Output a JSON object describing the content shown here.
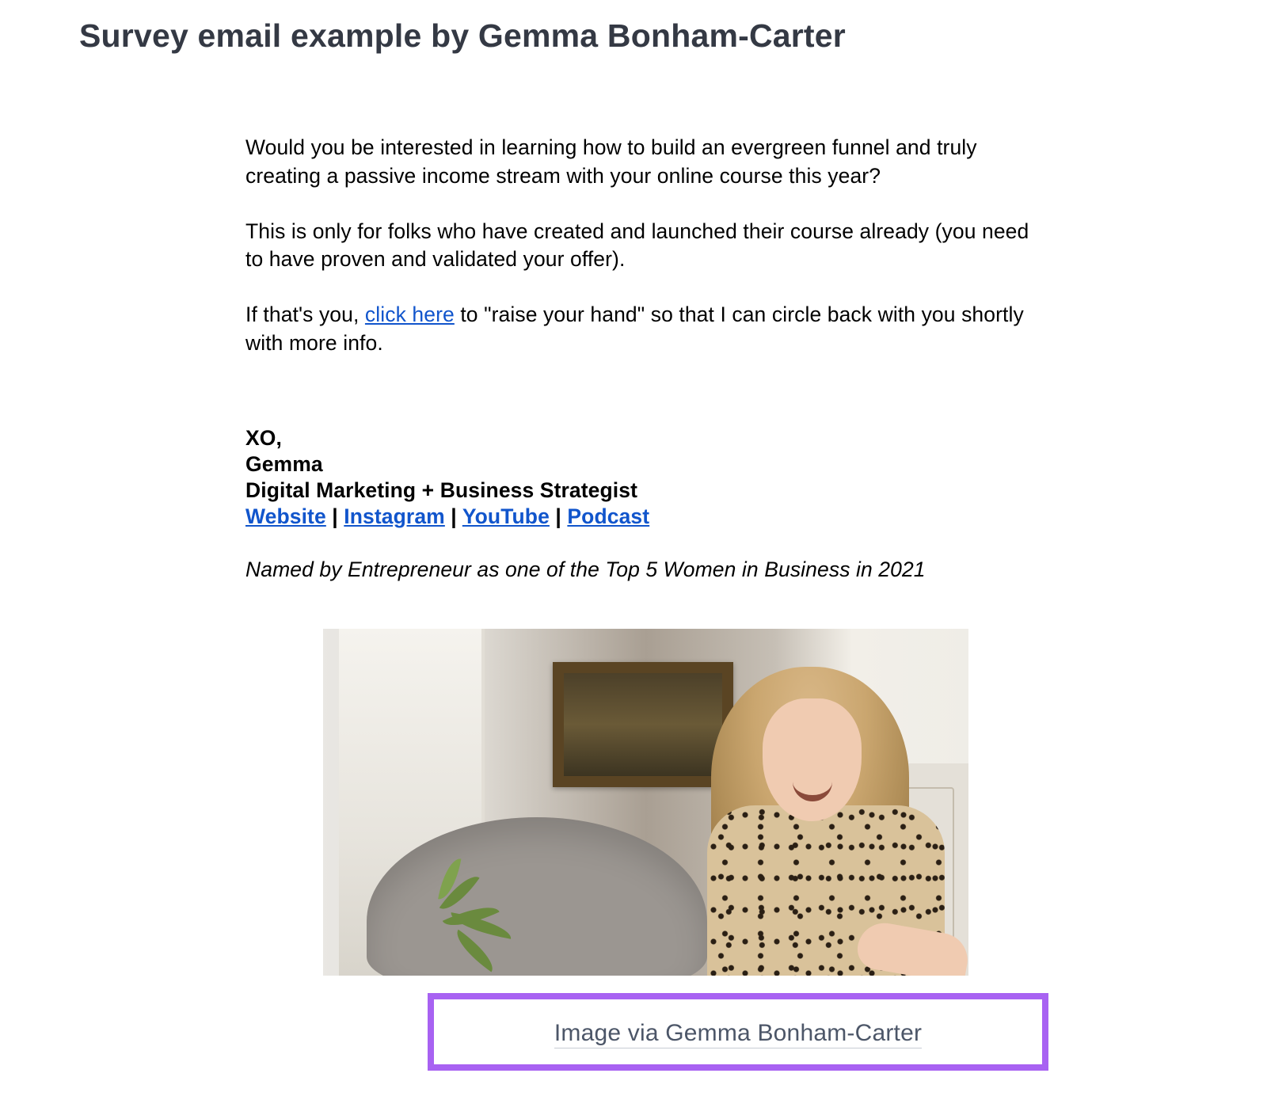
{
  "heading": "Survey email example by Gemma Bonham-Carter",
  "email": {
    "p1": "Would you be interested in learning how to build an evergreen funnel and truly creating a passive income stream with your online course this year?",
    "p2": "This is only for folks who have created and launched their course already (you need to have proven and validated your offer).",
    "p3_a": "If that's you, ",
    "p3_link": "click here",
    "p3_b": " to \"raise your hand\" so that I can circle back with you shortly with more info."
  },
  "signature": {
    "signoff": "XO,",
    "name": "Gemma",
    "title": "Digital Marketing + Business Strategist",
    "links": {
      "website": "Website",
      "instagram": "Instagram",
      "youtube": "YouTube",
      "podcast": "Podcast",
      "sep": " | "
    },
    "accolade": "Named by Entrepreneur as one of the Top 5 Women in Business in 2021"
  },
  "caption": {
    "text": "Image via Gemma Bonham-Carter"
  }
}
